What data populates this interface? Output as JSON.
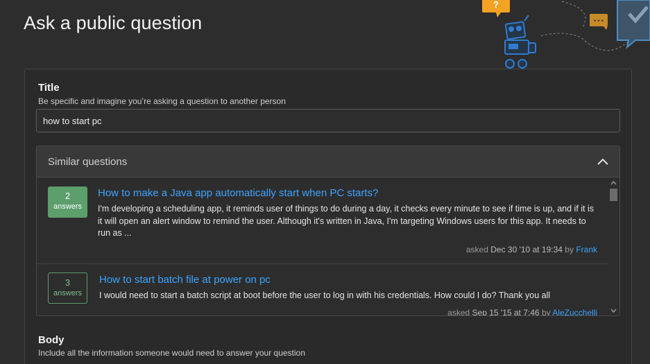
{
  "page": {
    "title": "Ask a public question"
  },
  "title_field": {
    "label": "Title",
    "hint": "Be specific and imagine you’re asking a question to another person",
    "value": "how to start pc"
  },
  "similar": {
    "header": "Similar questions",
    "results": [
      {
        "votes": "2",
        "votes_label": "answers",
        "title": "How to make a Java app automatically start when PC starts?",
        "excerpt": "I'm developing a scheduling app, it reminds user of things to do during a day, it checks every minute to see if time is up, and if it is it will open an alert window to remind the user. Although it's written in Java, I'm targeting Windows users for this app. It needs to run as ...",
        "asked_prefix": "asked",
        "date": "Dec 30 '10 at 19:34",
        "by": "by",
        "user": "Frank"
      },
      {
        "votes": "3",
        "votes_label": "answers",
        "title": "How to start batch file at power on pc",
        "excerpt": "I would need to start a batch script at boot before the user to log in with his credentials. How could I do? Thank you all",
        "asked_prefix": "asked",
        "date": "Sep 15 '15 at 7:46",
        "by": "by",
        "user": "AleZucchelli"
      }
    ]
  },
  "body_field": {
    "label": "Body",
    "hint": "Include all the information someone would need to answer your question"
  },
  "illustration": {
    "bubble_text": "?",
    "dots_text": "•••"
  },
  "colors": {
    "accent": "#3ca4ff",
    "answers_green": "#5c9e6c",
    "illustration_orange": "#f48024"
  }
}
